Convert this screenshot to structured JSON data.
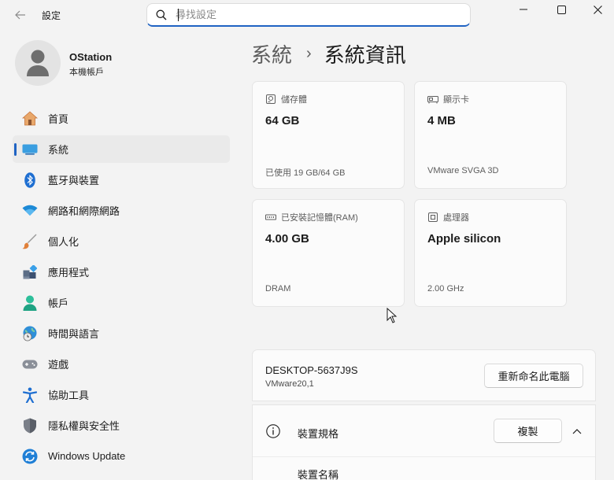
{
  "window": {
    "title": "設定",
    "back_icon": "back-arrow-icon",
    "controls": [
      "minimize-icon",
      "maximize-icon",
      "close-icon"
    ]
  },
  "search": {
    "placeholder": "尋找設定",
    "value": ""
  },
  "user": {
    "name": "OStation",
    "account_type": "本機帳戶"
  },
  "sidebar": {
    "items": [
      {
        "label": "首頁",
        "icon": "home-icon"
      },
      {
        "label": "系統",
        "icon": "system-icon",
        "active": true
      },
      {
        "label": "藍牙與裝置",
        "icon": "bluetooth-icon"
      },
      {
        "label": "網路和網際網路",
        "icon": "wifi-icon"
      },
      {
        "label": "個人化",
        "icon": "brush-icon"
      },
      {
        "label": "應用程式",
        "icon": "apps-icon"
      },
      {
        "label": "帳戶",
        "icon": "account-icon"
      },
      {
        "label": "時間與語言",
        "icon": "time-language-icon"
      },
      {
        "label": "遊戲",
        "icon": "gamepad-icon"
      },
      {
        "label": "協助工具",
        "icon": "accessibility-icon"
      },
      {
        "label": "隱私權與安全性",
        "icon": "shield-icon"
      },
      {
        "label": "Windows Update",
        "icon": "update-icon"
      }
    ]
  },
  "breadcrumb": {
    "parent": "系統",
    "separator": "›",
    "current": "系統資訊"
  },
  "cards": [
    {
      "title": "儲存體",
      "value": "64 GB",
      "sub": "已使用 19 GB/64 GB",
      "icon": "storage-icon"
    },
    {
      "title": "顯示卡",
      "value": "4 MB",
      "sub": "VMware SVGA 3D",
      "icon": "graphics-card-icon"
    },
    {
      "title": "已安裝記憶體(RAM)",
      "value": "4.00 GB",
      "sub": "DRAM",
      "icon": "ram-icon"
    },
    {
      "title": "處理器",
      "value": "Apple silicon",
      "sub": "2.00 GHz",
      "icon": "processor-icon"
    }
  ],
  "device": {
    "name": "DESKTOP-5637J9S",
    "model": "VMware20,1",
    "rename_button": "重新命名此電腦"
  },
  "specs": {
    "title": "裝置規格",
    "copy_button": "複製",
    "first_row_label": "裝置名稱"
  },
  "colors": {
    "accent": "#1f63c3",
    "background": "#f3f3f3",
    "card": "#fbfbfb"
  }
}
